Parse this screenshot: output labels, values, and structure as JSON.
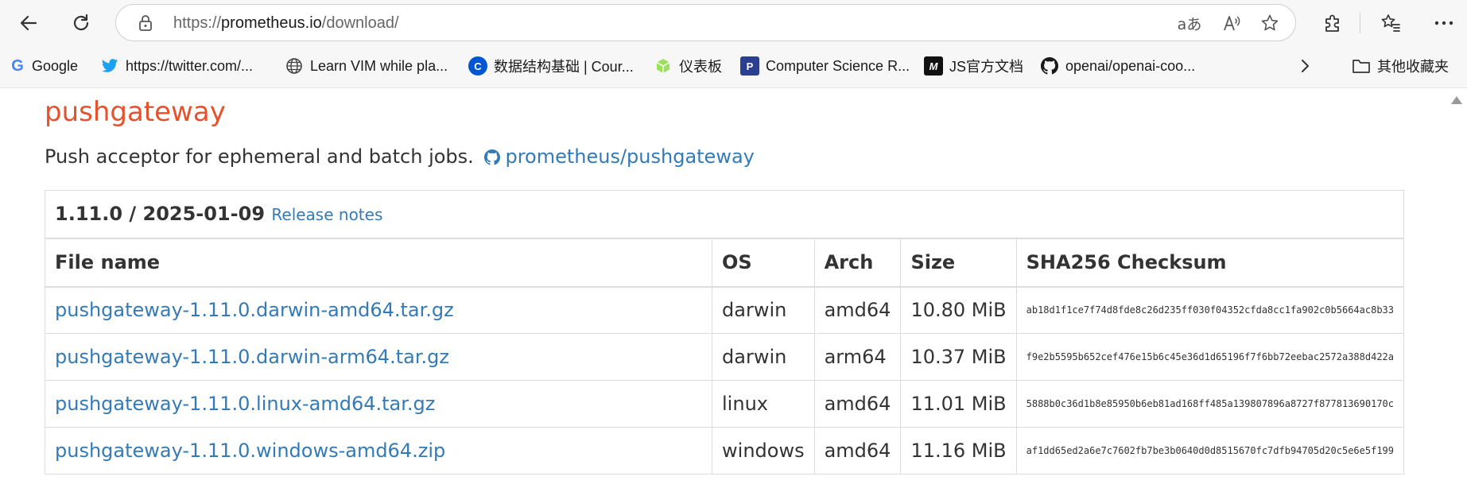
{
  "browser": {
    "url_prefix": "https://",
    "url_host": "prometheus.io",
    "url_path": "/download/",
    "read_aloud_glyph": "aあ"
  },
  "bookmarks": [
    {
      "label": "Google",
      "icon": "google-icon"
    },
    {
      "label": "https://twitter.com/...",
      "icon": "twitter-icon"
    },
    {
      "label": "Learn VIM while pla...",
      "icon": "globe-icon"
    },
    {
      "label": "数据结构基础 | Cour...",
      "icon": "coursera-icon"
    },
    {
      "label": "仪表板",
      "icon": "cube-icon"
    },
    {
      "label": "Computer Science R...",
      "icon": "p-icon"
    },
    {
      "label": "JS官方文档",
      "icon": "m-icon"
    },
    {
      "label": "openai/openai-coo...",
      "icon": "github-icon"
    },
    {
      "label": "其他收藏夹",
      "icon": "folder-icon"
    }
  ],
  "section": {
    "title": "pushgateway",
    "description": "Push acceptor for ephemeral and batch jobs.",
    "repo_link": "prometheus/pushgateway"
  },
  "release": {
    "version": "1.11.0 / 2025-01-09",
    "notes_link": "Release notes"
  },
  "table": {
    "headers": [
      "File name",
      "OS",
      "Arch",
      "Size",
      "SHA256 Checksum"
    ],
    "rows": [
      [
        "pushgateway-1.11.0.darwin-amd64.tar.gz",
        "darwin",
        "amd64",
        "10.80 MiB",
        "ab18d1f1ce7f74d8fde8c26d235ff030f04352cfda8cc1fa902c0b5664ac8b33"
      ],
      [
        "pushgateway-1.11.0.darwin-arm64.tar.gz",
        "darwin",
        "arm64",
        "10.37 MiB",
        "f9e2b5595b652cef476e15b6c45e36d1d65196f7f6bb72eebac2572a388d422a"
      ],
      [
        "pushgateway-1.11.0.linux-amd64.tar.gz",
        "linux",
        "amd64",
        "11.01 MiB",
        "5888b0c36d1b8e85950b6eb81ad168ff485a139807896a8727f877813690170c"
      ],
      [
        "pushgateway-1.11.0.windows-amd64.zip",
        "windows",
        "amd64",
        "11.16 MiB",
        "af1dd65ed2a6e7c7602fb7be3b0640d0d8515670fc7dfb94705d20c5e6e5f199"
      ]
    ]
  }
}
